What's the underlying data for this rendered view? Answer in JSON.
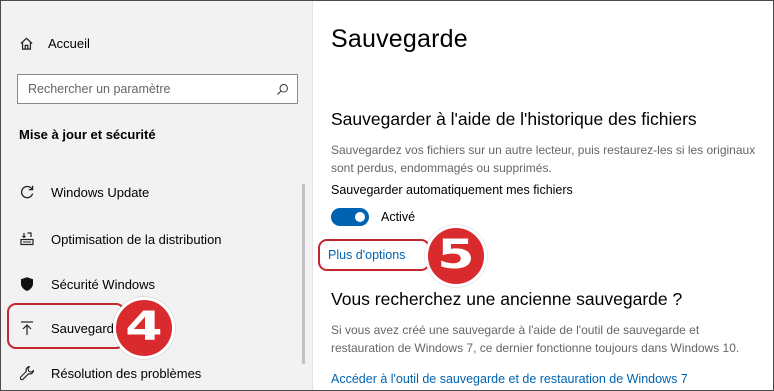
{
  "sidebar": {
    "home_label": "Accueil",
    "search_placeholder": "Rechercher un paramètre",
    "section_title": "Mise à jour et sécurité",
    "items": [
      {
        "label": "Windows Update",
        "icon": "refresh-icon"
      },
      {
        "label": "Optimisation de la distribution",
        "icon": "delivery-optimization-icon"
      },
      {
        "label": "Sécurité Windows",
        "icon": "shield-icon"
      },
      {
        "label": "Sauvegarde",
        "icon": "backup-arrow-icon",
        "selected": true
      },
      {
        "label": "Résolution des problèmes",
        "icon": "wrench-icon"
      }
    ]
  },
  "main": {
    "title": "Sauvegarde",
    "history_heading": "Sauvegarder à l'aide de l'historique des fichiers",
    "history_desc": "Sauvegardez vos fichiers sur un autre lecteur, puis restaurez-les si les originaux sont perdus, endommagés ou supprimés.",
    "auto_backup_label": "Sauvegarder automatiquement mes fichiers",
    "toggle_state": "Activé",
    "more_options_link": "Plus d'options",
    "old_backup_heading": "Vous recherchez une ancienne sauvegarde ?",
    "old_backup_desc": "Si vous avez créé une sauvegarde à l'aide de l'outil de sauvegarde et restauration de Windows 7, ce dernier fonctionne toujours dans Windows 10.",
    "win7_tool_link": "Accéder à l'outil de sauvegarde et de restauration de Windows 7"
  },
  "annotations": {
    "step4": "4",
    "step5": "5"
  },
  "colors": {
    "accent": "#0063b1",
    "callout_red": "#d92a2e",
    "sidebar_bg": "#f2f2f2"
  }
}
